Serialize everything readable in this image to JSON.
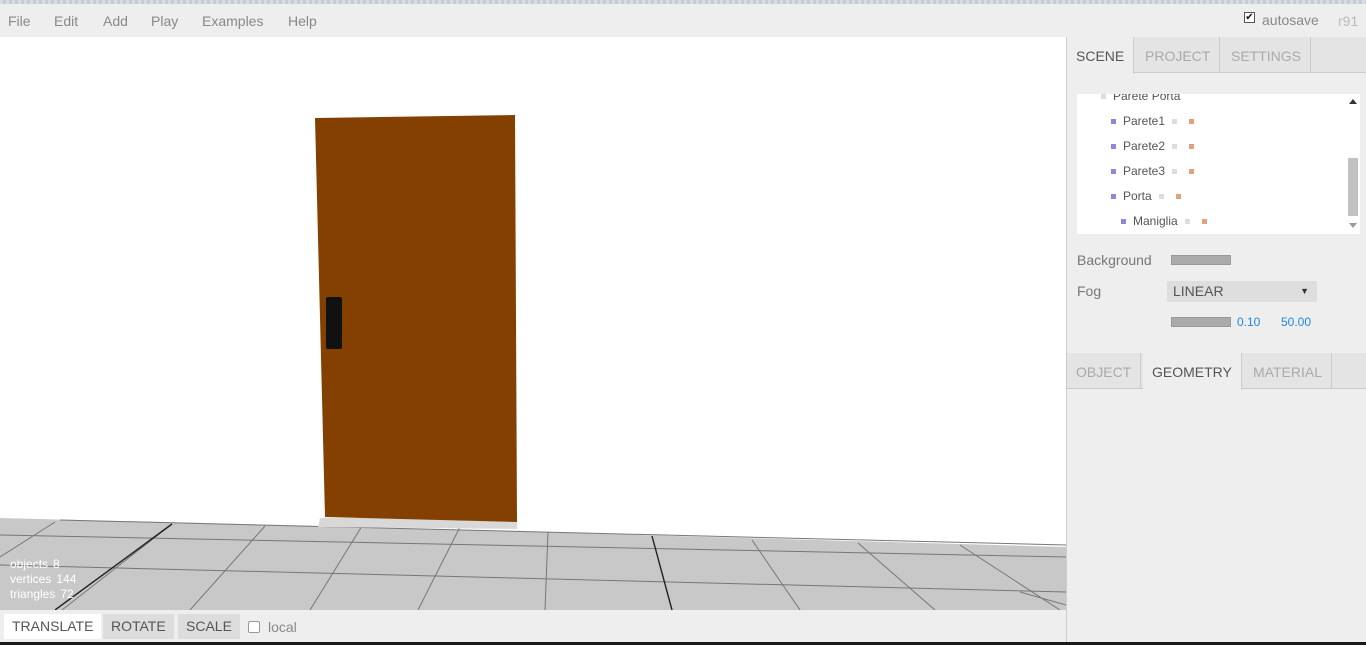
{
  "menu": {
    "items": [
      "File",
      "Edit",
      "Add",
      "Play",
      "Examples",
      "Help"
    ],
    "autosave_label": "autosave",
    "autosave_checked": true,
    "revision": "r91"
  },
  "viewport": {
    "stats": [
      {
        "label": "objects",
        "value": "8"
      },
      {
        "label": "vertices",
        "value": "144"
      },
      {
        "label": "triangles",
        "value": "72"
      }
    ],
    "colors": {
      "door": "#844000",
      "handle": "#111111",
      "floor": "#c8c8c8",
      "grid": "#777777",
      "background": "#ffffff"
    }
  },
  "toolbar": {
    "translate": "TRANSLATE",
    "rotate": "ROTATE",
    "scale": "SCALE",
    "local_label": "local"
  },
  "sidebar": {
    "top_tabs": [
      "SCENE",
      "PROJECT",
      "SETTINGS"
    ],
    "outliner": [
      {
        "name": "Parete Porta"
      },
      {
        "name": "Parete1"
      },
      {
        "name": "Parete2"
      },
      {
        "name": "Parete3"
      },
      {
        "name": "Porta"
      },
      {
        "name": "Maniglia"
      }
    ],
    "background_label": "Background",
    "fog_label": "Fog",
    "fog_type": "LINEAR",
    "fog_near": "0.10",
    "fog_far": "50.00",
    "bottom_tabs": [
      "OBJECT",
      "GEOMETRY",
      "MATERIAL"
    ]
  }
}
